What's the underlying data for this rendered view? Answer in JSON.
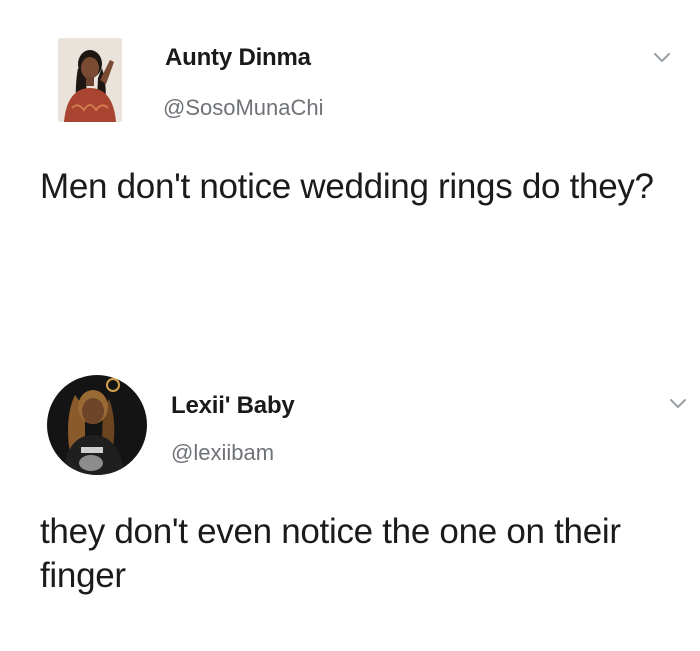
{
  "tweets": [
    {
      "author_name": "Aunty Dinma",
      "author_handle": "@SosoMunaChi",
      "text": "Men don't notice wedding rings do they?",
      "menu_icon": "chevron-down-icon"
    },
    {
      "author_name": "Lexii' Baby",
      "author_handle": "@lexiibam",
      "text": "they don't even notice the one on their finger",
      "menu_icon": "chevron-down-icon"
    }
  ],
  "colors": {
    "background": "#ffffff",
    "name": "#1a1a1a",
    "handle": "#6f7378",
    "body": "#1b1b1b",
    "chevron": "#9aa0a6"
  }
}
